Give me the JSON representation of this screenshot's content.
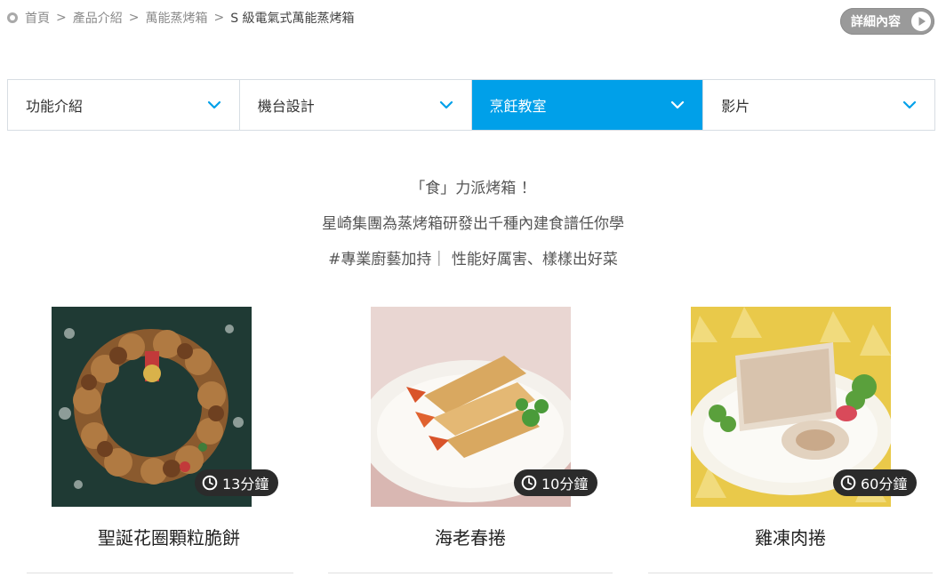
{
  "breadcrumb": {
    "items": [
      "首頁",
      "產品介紹",
      "萬能蒸烤箱"
    ],
    "separator": ">",
    "current": "S 級電氣式萬能蒸烤箱"
  },
  "detail_button": {
    "label": "詳細內容"
  },
  "tabs": [
    {
      "label": "功能介紹",
      "active": false
    },
    {
      "label": "機台設計",
      "active": false
    },
    {
      "label": "烹飪教室",
      "active": true
    },
    {
      "label": "影片",
      "active": false
    }
  ],
  "intro": {
    "line1": "「食」力派烤箱 ！",
    "line2": "星崎集團為蒸烤箱研發出千種內建食譜任你學",
    "line3": "#專業廚藝加持｜ 性能好厲害、樣樣出好菜"
  },
  "recipes": [
    {
      "title": "聖誕花圈顆粒脆餅",
      "time": "13分鐘"
    },
    {
      "title": "海老春捲",
      "time": "10分鐘"
    },
    {
      "title": "雞凍肉捲",
      "time": "60分鐘"
    }
  ],
  "colors": {
    "accent": "#00a0e9",
    "badge": "#2b2b2b",
    "detail_button": "#9a9a9a"
  }
}
